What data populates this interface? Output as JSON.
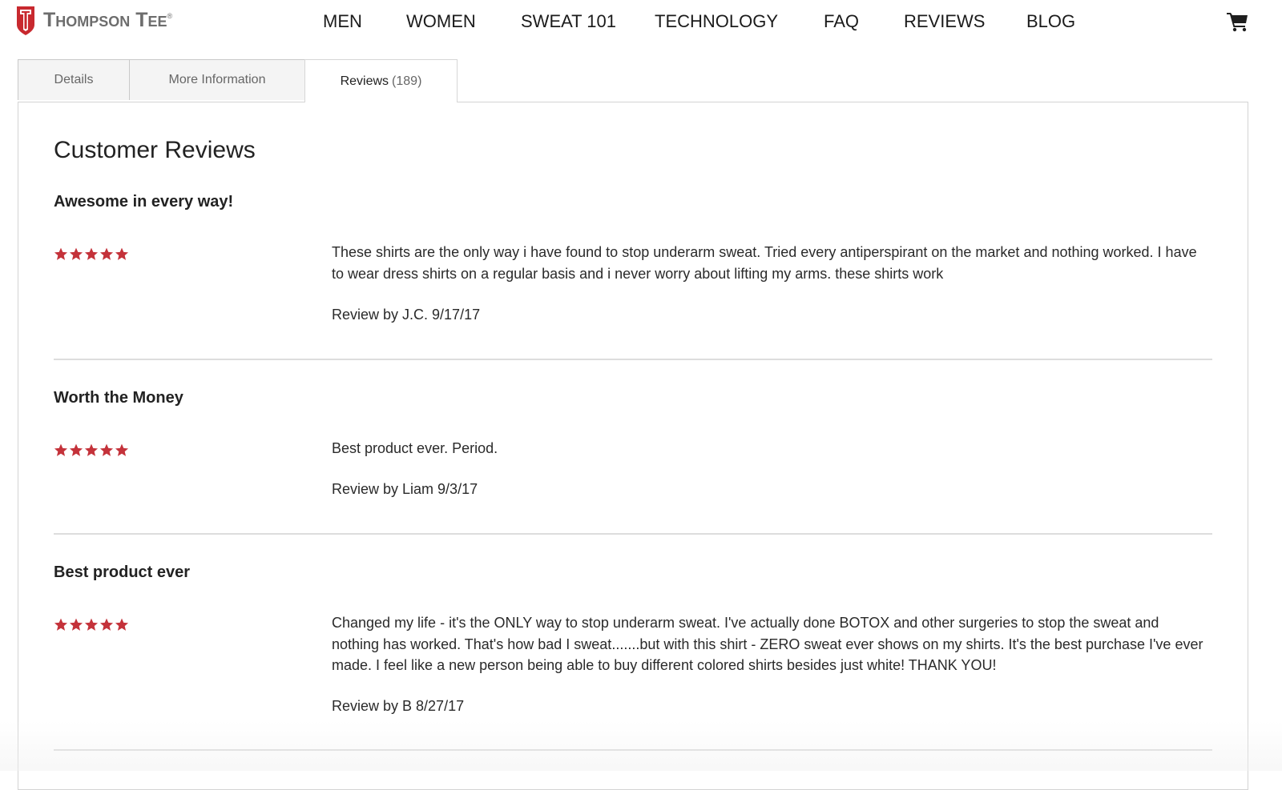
{
  "brand": {
    "name": "Thompson Tee",
    "registered_mark": "®",
    "logo_letter": "T",
    "color": "#c8292f"
  },
  "nav": {
    "items": [
      {
        "label": "MEN"
      },
      {
        "label": "WOMEN"
      },
      {
        "label": "SWEAT 101"
      },
      {
        "label": "TECHNOLOGY"
      },
      {
        "label": "FAQ"
      },
      {
        "label": "REVIEWS"
      },
      {
        "label": "BLOG"
      }
    ],
    "cart_icon": "shopping-cart-icon"
  },
  "tabs": [
    {
      "label": "Details",
      "count": "",
      "active": false
    },
    {
      "label": "More Information",
      "count": "",
      "active": false
    },
    {
      "label": "Reviews",
      "count": "(189)",
      "active": true
    }
  ],
  "reviews_panel": {
    "title": "Customer Reviews",
    "star_color": "#c4323a",
    "reviews": [
      {
        "title": "Awesome in every way!",
        "rating": 5,
        "max_rating": 5,
        "body": "These shirts are the only way i have found to stop underarm sweat. Tried every antiperspirant on the market and nothing worked. I have to wear dress shirts on a regular basis and i never worry about lifting my arms. these shirts work",
        "byline": "Review by J.C. 9/17/17"
      },
      {
        "title": "Worth the Money",
        "rating": 5,
        "max_rating": 5,
        "body": "Best product ever. Period.",
        "byline": "Review by Liam 9/3/17"
      },
      {
        "title": "Best product ever",
        "rating": 5,
        "max_rating": 5,
        "body": "Changed my life - it's the ONLY way to stop underarm sweat. I've actually done BOTOX and other surgeries to stop the sweat and nothing has worked. That's how bad I sweat.......but with this shirt - ZERO sweat ever shows on my shirts. It's the best purchase I've ever made. I feel like a new person being able to buy different colored shirts besides just white! THANK YOU!",
        "byline": "Review by B 8/27/17"
      }
    ]
  }
}
